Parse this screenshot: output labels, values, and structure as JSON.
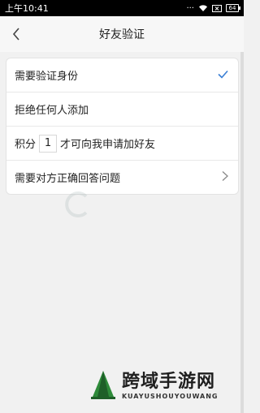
{
  "statusbar": {
    "time": "上午10:41",
    "battery_level": "64"
  },
  "header": {
    "title": "好友验证"
  },
  "options": [
    {
      "label": "需要验证身份",
      "selected": true
    },
    {
      "label": "拒绝任何人添加",
      "selected": false
    },
    {
      "label_prefix": "积分",
      "points": "1",
      "label_suffix": "才可向我申请加好友"
    },
    {
      "label": "需要对方正确回答问题",
      "has_arrow": true
    }
  ],
  "watermark": {
    "site_name": "跨域手游网",
    "site_pinyin": "KUAYUSHOUYOUWANG"
  },
  "colors": {
    "accent": "#3a7fd5",
    "background": "#f1f1f1"
  }
}
